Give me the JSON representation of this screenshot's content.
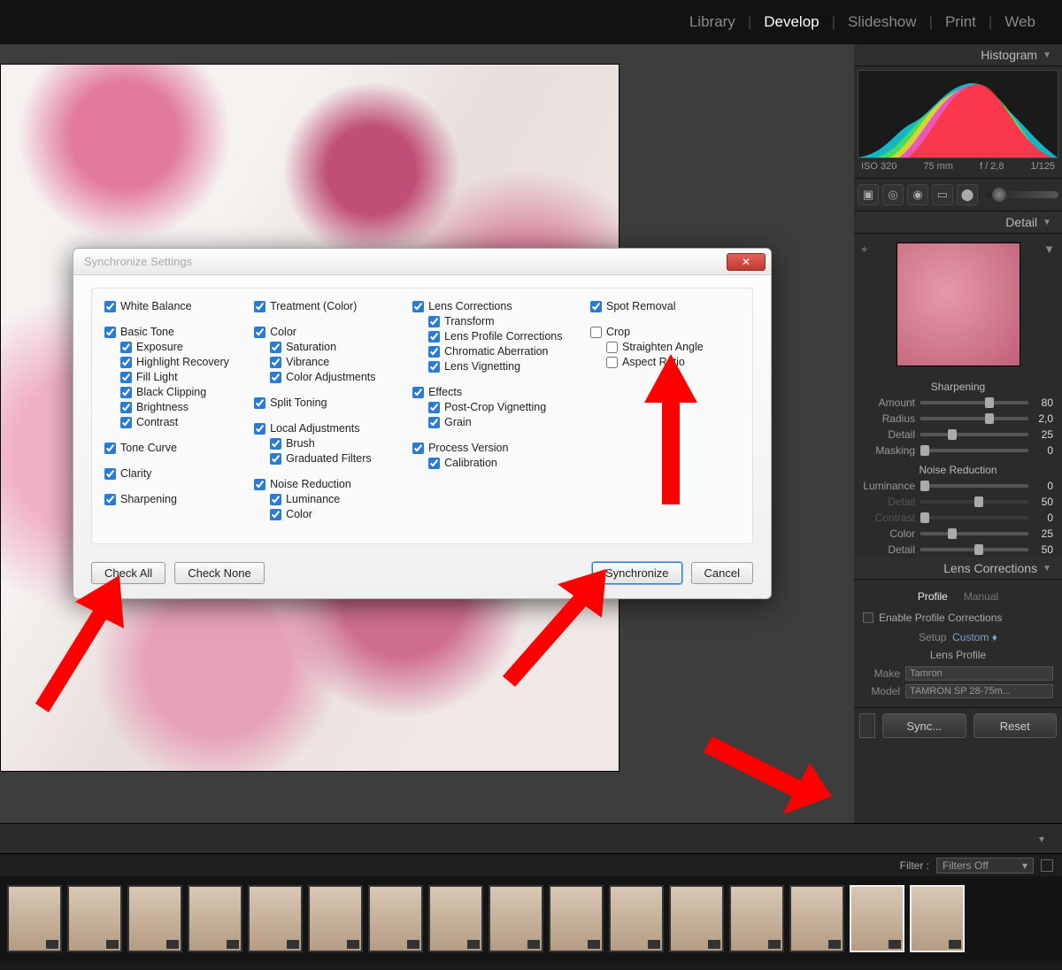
{
  "nav": {
    "library": "Library",
    "develop": "Develop",
    "slideshow": "Slideshow",
    "print": "Print",
    "web": "Web"
  },
  "panels": {
    "histogram": "Histogram",
    "histo_meta": {
      "iso": "ISO 320",
      "fl": "75 mm",
      "ap": "f / 2,8",
      "sh": "1/125"
    },
    "detail": "Detail",
    "sharpening": "Sharpening",
    "sharp": [
      {
        "label": "Amount",
        "value": "80",
        "pos": 60,
        "accent": true
      },
      {
        "label": "Radius",
        "value": "2,0",
        "pos": 60
      },
      {
        "label": "Detail",
        "value": "25",
        "pos": 25
      },
      {
        "label": "Masking",
        "value": "0",
        "pos": 0
      }
    ],
    "noise": "Noise Reduction",
    "nr": [
      {
        "label": "Luminance",
        "value": "0",
        "pos": 0,
        "dim": false
      },
      {
        "label": "Detail",
        "value": "50",
        "pos": 50,
        "dim": true
      },
      {
        "label": "Contrast",
        "value": "0",
        "pos": 0,
        "dim": true
      },
      {
        "label": "Color",
        "value": "25",
        "pos": 25,
        "dim": false
      },
      {
        "label": "Detail",
        "value": "50",
        "pos": 50,
        "dim": false
      }
    ],
    "lenscorr": "Lens Corrections",
    "tabs": {
      "profile": "Profile",
      "manual": "Manual"
    },
    "enable_profile": "Enable Profile Corrections",
    "setup": {
      "label": "Setup",
      "value": "Custom"
    },
    "lensprofile": "Lens Profile",
    "make": {
      "label": "Make",
      "value": "Tamron"
    },
    "model": {
      "label": "Model",
      "value": "TAMRON SP 28-75m..."
    }
  },
  "buttons": {
    "sync": "Sync...",
    "reset": "Reset"
  },
  "filter": {
    "label": "Filter :",
    "value": "Filters Off"
  },
  "dialog": {
    "title": "Synchronize Settings",
    "check_all": "Check All",
    "check_none": "Check None",
    "synchronize": "Synchronize",
    "cancel": "Cancel",
    "c1": {
      "white_balance": "White Balance",
      "basic_tone": "Basic Tone",
      "bt": [
        "Exposure",
        "Highlight Recovery",
        "Fill Light",
        "Black Clipping",
        "Brightness",
        "Contrast"
      ],
      "tone_curve": "Tone Curve",
      "clarity": "Clarity",
      "sharpening": "Sharpening"
    },
    "c2": {
      "treatment": "Treatment (Color)",
      "color": "Color",
      "color_sub": [
        "Saturation",
        "Vibrance",
        "Color Adjustments"
      ],
      "split": "Split Toning",
      "local": "Local Adjustments",
      "local_sub": [
        "Brush",
        "Graduated Filters"
      ],
      "noise": "Noise Reduction",
      "noise_sub": [
        "Luminance",
        "Color"
      ]
    },
    "c3": {
      "lens": "Lens Corrections",
      "lens_sub": [
        "Transform",
        "Lens Profile Corrections",
        "Chromatic Aberration",
        "Lens Vignetting"
      ],
      "effects": "Effects",
      "effects_sub": [
        "Post-Crop Vignetting",
        "Grain"
      ],
      "process": "Process Version",
      "process_sub": [
        "Calibration"
      ]
    },
    "c4": {
      "spot": "Spot Removal",
      "crop": "Crop",
      "crop_sub": [
        "Straighten Angle",
        "Aspect Ratio"
      ]
    }
  }
}
